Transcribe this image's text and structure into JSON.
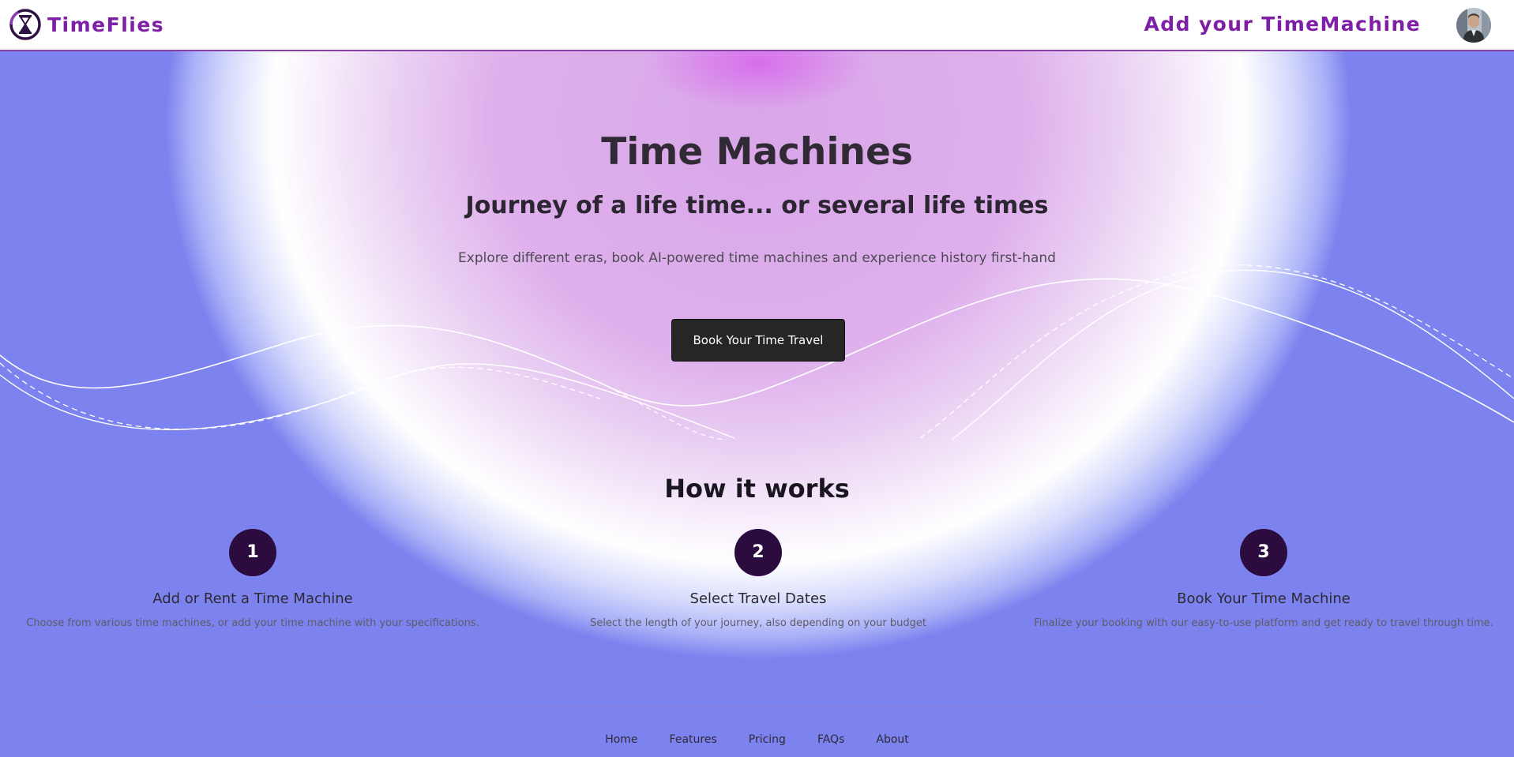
{
  "header": {
    "brand": "TimeFlies",
    "add_link": "Add your TimeMachine",
    "brand_color": "#7e1fa6",
    "border_color": "#8a3fb0"
  },
  "hero": {
    "title": "Time Machines",
    "subtitle": "Journey of a life time... or several life times",
    "description": "Explore different eras, book AI-powered time machines and experience history first-hand",
    "cta_label": "Book Your Time Travel"
  },
  "how": {
    "title": "How it works",
    "steps": [
      {
        "num": "1",
        "title": "Add or Rent a Time Machine",
        "desc": "Choose from various time machines, or add your time machine with your specifications."
      },
      {
        "num": "2",
        "title": "Select Travel Dates",
        "desc": "Select the length of your journey, also depending on your budget"
      },
      {
        "num": "3",
        "title": "Book Your Time Machine",
        "desc": "Finalize your booking with our easy-to-use platform and get ready to travel through time."
      }
    ]
  },
  "footer": {
    "links": [
      "Home",
      "Features",
      "Pricing",
      "FAQs",
      "About"
    ]
  },
  "icons": {
    "logo": "hourglass-icon",
    "avatar": "user-avatar"
  },
  "colors": {
    "step_circle": "#2c0b3f",
    "cta_bg": "#262626",
    "page_edge": "#6f74ea"
  }
}
